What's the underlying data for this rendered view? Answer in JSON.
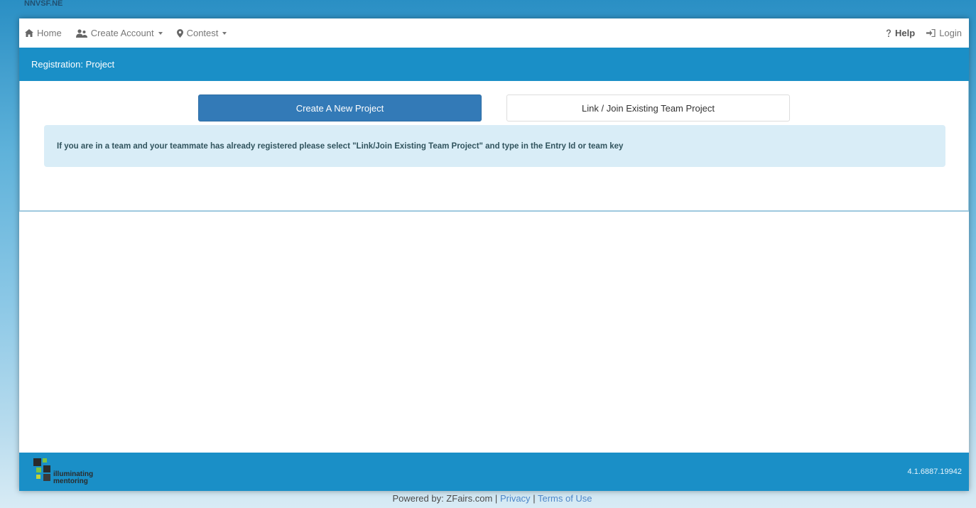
{
  "top_strip": {
    "text": "NNVSF.NE"
  },
  "navbar": {
    "home": {
      "label": "Home",
      "icon": "home-icon"
    },
    "create_account": {
      "label": "Create Account",
      "icon": "users-icon"
    },
    "contest": {
      "label": "Contest",
      "icon": "map-marker-icon"
    },
    "help": {
      "label": "Help",
      "icon": "question-icon"
    },
    "login": {
      "label": "Login",
      "icon": "sign-in-icon"
    }
  },
  "panel": {
    "heading": "Registration: Project",
    "create_button": "Create A New Project",
    "link_button": "Link / Join Existing Team Project",
    "alert": "If you are in a team and your teammate has already registered please select \"Link/Join Existing Team Project\" and type in the Entry Id or team key"
  },
  "footer": {
    "logo_text_top": "illuminating",
    "logo_text_bottom": "mentoring",
    "version": "4.1.6887.19942"
  },
  "powered": {
    "prefix": "Powered by: ZFairs.com |",
    "privacy": "Privacy",
    "separator": "|",
    "terms": "Terms of Use"
  },
  "colors": {
    "primary_bar": "#1a8fc7",
    "button_primary": "#337ab7",
    "alert_bg": "#d9edf7",
    "link": "#4d86c8"
  }
}
